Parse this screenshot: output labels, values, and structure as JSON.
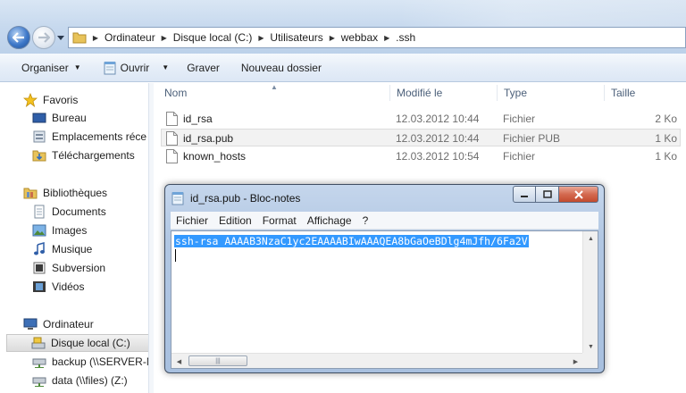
{
  "explorer": {
    "breadcrumb": [
      "Ordinateur",
      "Disque local (C:)",
      "Utilisateurs",
      "webbax",
      ".ssh"
    ],
    "toolbar": {
      "organise": "Organiser",
      "open": "Ouvrir",
      "burn": "Graver",
      "new_folder": "Nouveau dossier"
    },
    "nav": {
      "favorites_header": "Favoris",
      "favorites": [
        "Bureau",
        "Emplacements réce",
        "Téléchargements"
      ],
      "libraries_header": "Bibliothèques",
      "libraries": [
        "Documents",
        "Images",
        "Musique",
        "Subversion",
        "Vidéos"
      ],
      "computer_header": "Ordinateur",
      "computer": [
        "Disque local (C:)",
        "backup (\\\\SERVER-N",
        "data (\\\\files) (Z:)"
      ]
    },
    "columns": {
      "name": "Nom",
      "modified": "Modifié le",
      "type": "Type",
      "size": "Taille"
    },
    "files": [
      {
        "name": "id_rsa",
        "modified": "12.03.2012 10:44",
        "type": "Fichier",
        "size": "2 Ko"
      },
      {
        "name": "id_rsa.pub",
        "modified": "12.03.2012 10:44",
        "type": "Fichier PUB",
        "size": "1 Ko"
      },
      {
        "name": "known_hosts",
        "modified": "12.03.2012 10:54",
        "type": "Fichier",
        "size": "1 Ko"
      }
    ]
  },
  "notepad": {
    "title": "id_rsa.pub - Bloc-notes",
    "menu": [
      "Fichier",
      "Edition",
      "Format",
      "Affichage",
      "?"
    ],
    "content": "ssh-rsa AAAAB3NzaC1yc2EAAAABIwAAAQEA8bGaOeBDlg4mJfh/6Fa2V"
  },
  "colors": {
    "selection": "#3399ff",
    "close_button": "#c24a2e",
    "toolbar_bg": "#dce7f5"
  }
}
